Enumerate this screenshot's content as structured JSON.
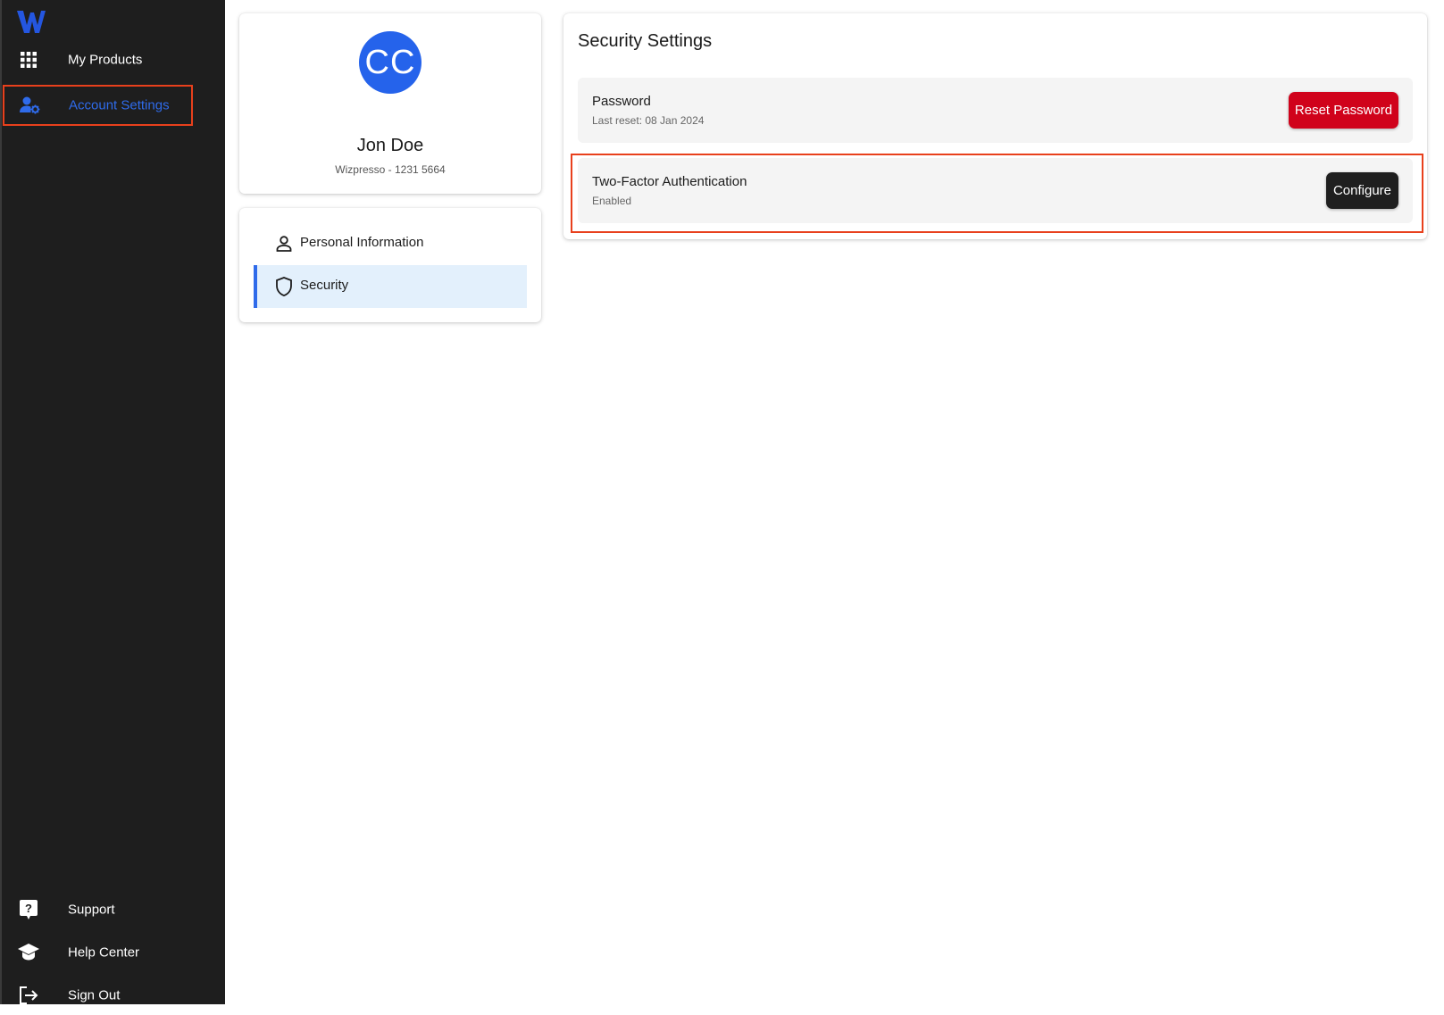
{
  "sidebar": {
    "top_items": [
      {
        "label": "My Products",
        "icon": "grid-icon"
      },
      {
        "label": "Account Settings",
        "icon": "user-gear-icon",
        "active": true
      }
    ],
    "bottom_items": [
      {
        "label": "Support",
        "icon": "question-icon"
      },
      {
        "label": "Help Center",
        "icon": "graduation-cap-icon"
      },
      {
        "label": "Sign Out",
        "icon": "sign-out-icon"
      }
    ]
  },
  "profile": {
    "initials": "CC",
    "name": "Jon Doe",
    "subtitle": "Wizpresso - 1231 5664"
  },
  "settings_menu": {
    "items": [
      {
        "label": "Personal Information",
        "icon": "person-icon"
      },
      {
        "label": "Security",
        "icon": "shield-icon",
        "selected": true
      }
    ]
  },
  "security": {
    "title": "Security Settings",
    "password": {
      "title": "Password",
      "subtitle": "Last reset: 08 Jan 2024",
      "button": "Reset Password"
    },
    "two_factor": {
      "title": "Two-Factor Authentication",
      "subtitle": "Enabled",
      "button": "Configure"
    }
  },
  "colors": {
    "accent": "#2f6bea",
    "danger": "#d0021b",
    "sidebar_bg": "#1e1e1e",
    "highlight": "#e8401c"
  }
}
